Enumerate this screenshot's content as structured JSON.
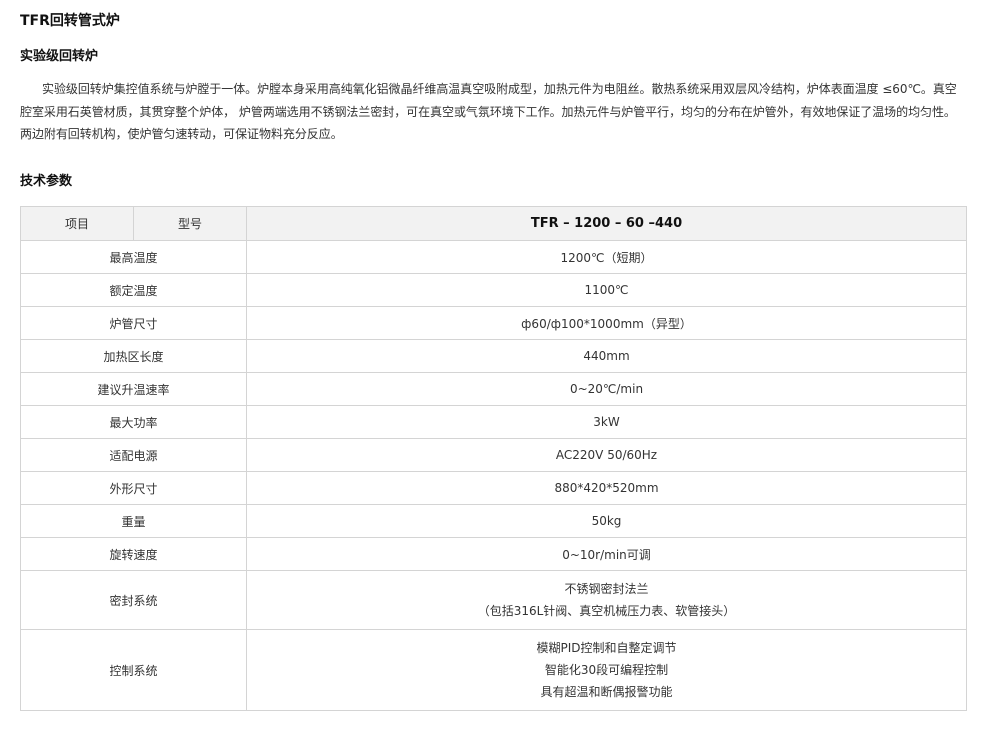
{
  "page": {
    "title": "TFR回转管式炉",
    "subtitle": "实验级回转炉",
    "intro": "实验级回转炉集控值系统与炉膛于一体。炉膛本身采用高纯氧化铝微晶纤维高温真空吸附成型，加热元件为电阻丝。散热系统采用双层风冷结构，炉体表面温度 ≤60℃。真空腔室采用石英管材质，其贯穿整个炉体，  炉管两端选用不锈钢法兰密封，可在真空或气氛环境下工作。加热元件与炉管平行，均匀的分布在炉管外，有效地保证了温场的均匀性。两边附有回转机构，使炉管匀速转动，可保证物料充分反应。",
    "specs_heading": "技术参数"
  },
  "table": {
    "header": {
      "item_label": "项目",
      "model_label": "型号",
      "model_value": "TFR – 1200 – 60 –440"
    },
    "rows": [
      {
        "label": "最高温度",
        "value": "1200℃（短期）"
      },
      {
        "label": "额定温度",
        "value": "1100℃"
      },
      {
        "label": "炉管尺寸",
        "value": "ф60/ф100*1000mm（异型）"
      },
      {
        "label": "加热区长度",
        "value": "440mm"
      },
      {
        "label": "建议升温速率",
        "value": "0~20℃/min"
      },
      {
        "label": "最大功率",
        "value": "3kW"
      },
      {
        "label": "适配电源",
        "value": "AC220V 50/60Hz"
      },
      {
        "label": "外形尺寸",
        "value": "880*420*520mm"
      },
      {
        "label": "重量",
        "value": "50kg"
      },
      {
        "label": "旋转速度",
        "value": "0~10r/min可调"
      }
    ],
    "sealing": {
      "label": "密封系统",
      "lines": [
        "不锈钢密封法兰",
        "（包括316L针阀、真空机械压力表、软管接头）"
      ]
    },
    "control": {
      "label": "控制系统",
      "lines": [
        "模糊PID控制和自整定调节",
        "智能化30段可编程控制",
        "具有超温和断偶报警功能"
      ]
    }
  }
}
